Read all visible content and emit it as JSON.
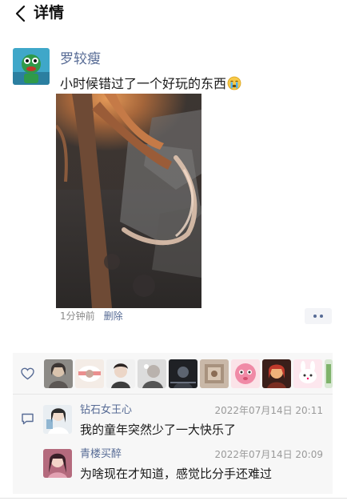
{
  "header": {
    "title": "详情",
    "back_icon": "chevron-left-icon"
  },
  "post": {
    "author": "罗较瘦",
    "text": "小时候错过了一个好玩的东西",
    "emoji": "crying-face-emoji",
    "image_desc_icon": "photo-thumbnail",
    "time": "1分钟前",
    "delete_label": "删除",
    "more_icon": "more-dots-icon"
  },
  "likes": {
    "icon": "heart-outline-icon",
    "count_shown": 10
  },
  "comments": {
    "icon": "comment-outline-icon",
    "items": [
      {
        "name": "钻石女王心",
        "time": "2022年07月14日 20:11",
        "text": "我的童年突然少了一大快乐了"
      },
      {
        "name": "青楼买醉",
        "time": "2022年07月14日 20:09",
        "text": "为啥现在才知道，感觉比分手还难过"
      }
    ]
  },
  "colors": {
    "link": "#576b95",
    "meta_gray": "#8a8a8a",
    "panel_bg": "#f7f7f7",
    "text": "#191919"
  }
}
